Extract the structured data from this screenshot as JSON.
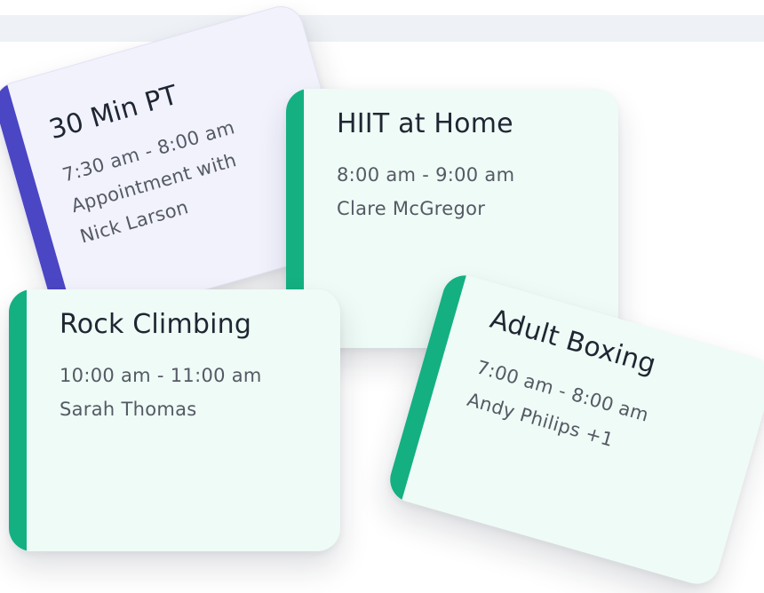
{
  "cards": [
    {
      "title": "30 Min PT",
      "lines": [
        "7:30 am - 8:00 am",
        "Appointment with",
        "Nick Larson"
      ],
      "accent_color": "#4b46c4",
      "background_color": "#f2f2fd"
    },
    {
      "title": "HIIT at Home",
      "lines": [
        "8:00 am - 9:00 am",
        "Clare McGregor"
      ],
      "accent_color": "#14b082",
      "background_color": "#effbf6"
    },
    {
      "title": "Rock Climbing",
      "lines": [
        "10:00 am - 11:00 am",
        "Sarah Thomas"
      ],
      "accent_color": "#14b082",
      "background_color": "#effbf6"
    },
    {
      "title": "Adult Boxing",
      "lines": [
        "7:00 am - 8:00 am",
        "Andy Philips +1"
      ],
      "accent_color": "#14b082",
      "background_color": "#effbf6"
    }
  ]
}
